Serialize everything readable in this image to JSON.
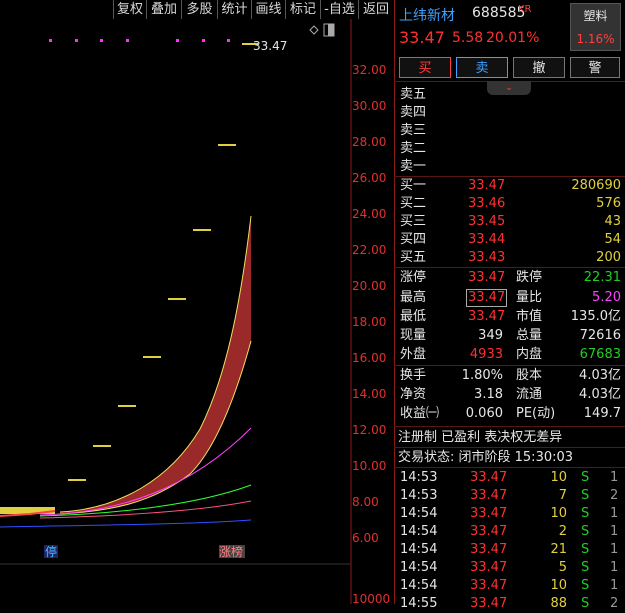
{
  "toolbar": {
    "items": [
      "复权",
      "叠加",
      "多股",
      "统计",
      "画线",
      "标记",
      "-自选",
      "返回"
    ]
  },
  "chart": {
    "price_labels": [
      "32.00",
      "30.00",
      "28.00",
      "26.00",
      "24.00",
      "22.00",
      "20.00",
      "18.00",
      "16.00",
      "14.00",
      "12.00",
      "10.00",
      "8.00",
      "6.00"
    ],
    "bottom_label": "10000",
    "last_price_tag": "33.47",
    "marker_stop": "停",
    "marker_limit": "涨榜"
  },
  "quote": {
    "name": "上纬新材",
    "code": "688585",
    "suffix": "KR",
    "tag": "塑料",
    "tag_pct": "1.16%",
    "price": "33.47",
    "change": "5.58",
    "change_pct": "20.01%"
  },
  "actions": [
    "买",
    "卖",
    "撤",
    "警"
  ],
  "sell_levels": [
    "卖五",
    "卖四",
    "卖三",
    "卖二",
    "卖一"
  ],
  "buy_levels": [
    {
      "label": "买一",
      "price": "33.47",
      "vol": "280690"
    },
    {
      "label": "买二",
      "price": "33.46",
      "vol": "576"
    },
    {
      "label": "买三",
      "price": "33.45",
      "vol": "43"
    },
    {
      "label": "买四",
      "price": "33.44",
      "vol": "54"
    },
    {
      "label": "买五",
      "price": "33.43",
      "vol": "200"
    }
  ],
  "stats": [
    [
      {
        "k": "涨停",
        "v": "33.47",
        "c": "red"
      },
      {
        "k": "跌停",
        "v": "22.31",
        "c": "green"
      }
    ],
    [
      {
        "k": "最高",
        "v": "33.47",
        "c": "red"
      },
      {
        "k": "量比",
        "v": "5.20",
        "c": "mag"
      }
    ],
    [
      {
        "k": "最低",
        "v": "33.47",
        "c": "red"
      },
      {
        "k": "市值",
        "v": "135.0亿",
        "c": "white"
      }
    ],
    [
      {
        "k": "现量",
        "v": "349",
        "c": "white"
      },
      {
        "k": "总量",
        "v": "72616",
        "c": "white"
      }
    ],
    [
      {
        "k": "外盘",
        "v": "4933",
        "c": "red"
      },
      {
        "k": "内盘",
        "v": "67683",
        "c": "green"
      }
    ]
  ],
  "stats2": [
    [
      {
        "k": "换手",
        "v": "1.80%"
      },
      {
        "k": "股本",
        "v": "4.03亿"
      }
    ],
    [
      {
        "k": "净资",
        "v": "3.18"
      },
      {
        "k": "流通",
        "v": "4.03亿"
      }
    ],
    [
      {
        "k": "收益㈠",
        "v": "0.060"
      },
      {
        "k": "PE(动)",
        "v": "149.7"
      }
    ]
  ],
  "note": "注册制 已盈利 表决权无差异",
  "trade_status": "交易状态: 闭市阶段 15:30:03",
  "ticks": [
    {
      "t": "14:53",
      "p": "33.47",
      "v": "10",
      "s": "S",
      "n": "1"
    },
    {
      "t": "14:53",
      "p": "33.47",
      "v": "7",
      "s": "S",
      "n": "2"
    },
    {
      "t": "14:54",
      "p": "33.47",
      "v": "10",
      "s": "S",
      "n": "1"
    },
    {
      "t": "14:54",
      "p": "33.47",
      "v": "2",
      "s": "S",
      "n": "1"
    },
    {
      "t": "14:54",
      "p": "33.47",
      "v": "21",
      "s": "S",
      "n": "1"
    },
    {
      "t": "14:54",
      "p": "33.47",
      "v": "5",
      "s": "S",
      "n": "1"
    },
    {
      "t": "14:54",
      "p": "33.47",
      "v": "10",
      "s": "S",
      "n": "1"
    },
    {
      "t": "14:55",
      "p": "33.47",
      "v": "88",
      "s": "S",
      "n": "2"
    }
  ]
}
